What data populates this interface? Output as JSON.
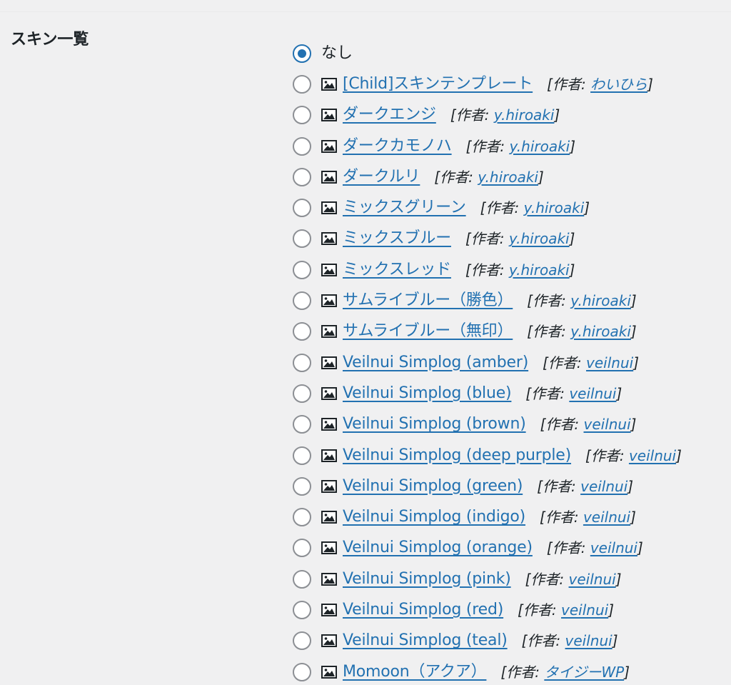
{
  "section": {
    "title": "スキン一覧"
  },
  "author_prefix": "[作者: ",
  "author_suffix": "]",
  "colors": {
    "link": "#2271b1",
    "text": "#1d2327",
    "radio_border": "#8c8f94",
    "radio_checked": "#2271b1",
    "background": "#f0f0f1"
  },
  "skins": [
    {
      "name": "なし",
      "selected": true,
      "has_preview": false,
      "author": null
    },
    {
      "name": "[Child]スキンテンプレート",
      "selected": false,
      "has_preview": true,
      "author": "わいひら"
    },
    {
      "name": "ダークエンジ",
      "selected": false,
      "has_preview": true,
      "author": "y.hiroaki"
    },
    {
      "name": "ダークカモノハ",
      "selected": false,
      "has_preview": true,
      "author": "y.hiroaki"
    },
    {
      "name": "ダークルリ",
      "selected": false,
      "has_preview": true,
      "author": "y.hiroaki"
    },
    {
      "name": "ミックスグリーン",
      "selected": false,
      "has_preview": true,
      "author": "y.hiroaki"
    },
    {
      "name": "ミックスブルー",
      "selected": false,
      "has_preview": true,
      "author": "y.hiroaki"
    },
    {
      "name": "ミックスレッド",
      "selected": false,
      "has_preview": true,
      "author": "y.hiroaki"
    },
    {
      "name": "サムライブルー（勝色）",
      "selected": false,
      "has_preview": true,
      "author": "y.hiroaki"
    },
    {
      "name": "サムライブルー（無印）",
      "selected": false,
      "has_preview": true,
      "author": "y.hiroaki"
    },
    {
      "name": "Veilnui Simplog (amber)",
      "selected": false,
      "has_preview": true,
      "author": "veilnui"
    },
    {
      "name": "Veilnui Simplog (blue)",
      "selected": false,
      "has_preview": true,
      "author": "veilnui"
    },
    {
      "name": "Veilnui Simplog (brown)",
      "selected": false,
      "has_preview": true,
      "author": "veilnui"
    },
    {
      "name": "Veilnui Simplog (deep purple)",
      "selected": false,
      "has_preview": true,
      "author": "veilnui"
    },
    {
      "name": "Veilnui Simplog (green)",
      "selected": false,
      "has_preview": true,
      "author": "veilnui"
    },
    {
      "name": "Veilnui Simplog (indigo)",
      "selected": false,
      "has_preview": true,
      "author": "veilnui"
    },
    {
      "name": "Veilnui Simplog (orange)",
      "selected": false,
      "has_preview": true,
      "author": "veilnui"
    },
    {
      "name": "Veilnui Simplog (pink)",
      "selected": false,
      "has_preview": true,
      "author": "veilnui"
    },
    {
      "name": "Veilnui Simplog (red)",
      "selected": false,
      "has_preview": true,
      "author": "veilnui"
    },
    {
      "name": "Veilnui Simplog (teal)",
      "selected": false,
      "has_preview": true,
      "author": "veilnui"
    },
    {
      "name": "Momoon（アクア）",
      "selected": false,
      "has_preview": true,
      "author": "タイジーWP"
    }
  ]
}
